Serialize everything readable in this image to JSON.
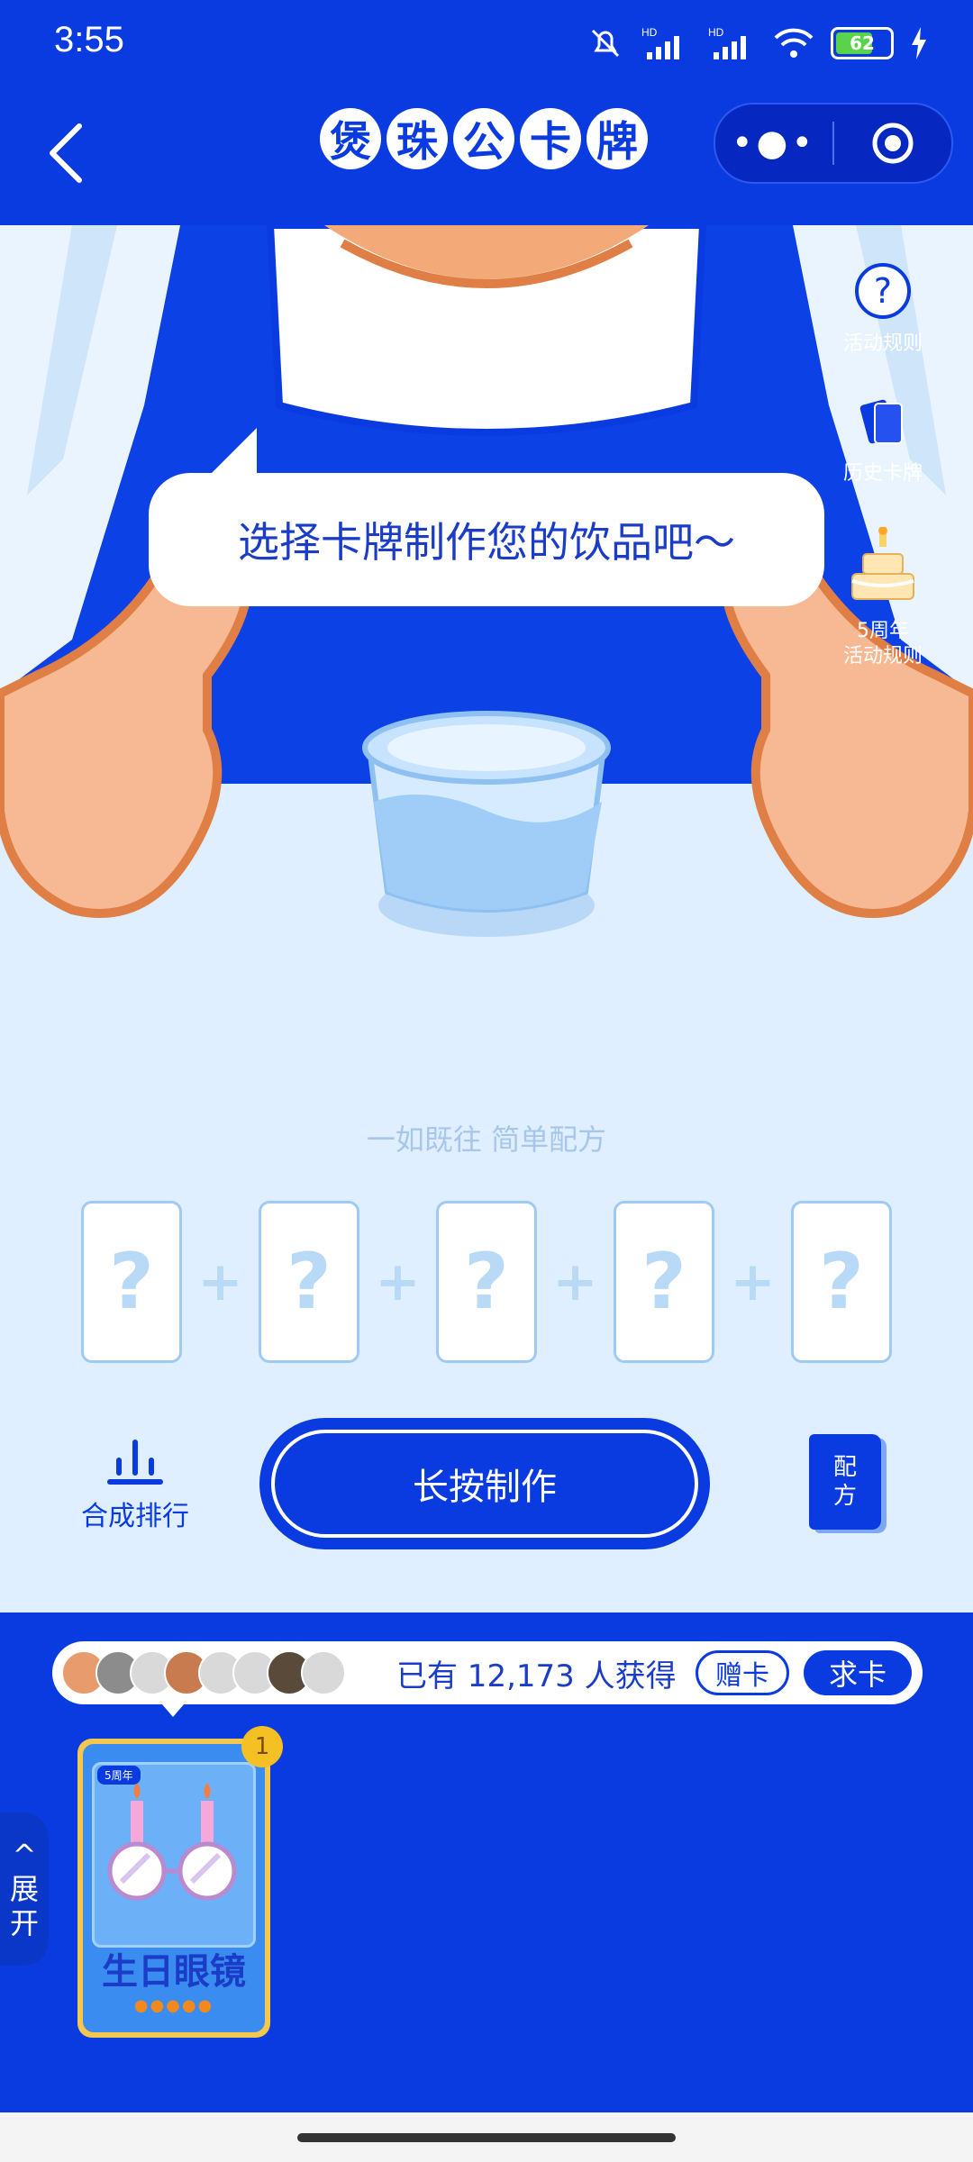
{
  "status_bar": {
    "time": "3:55",
    "hd1": "HD",
    "hd2": "HD",
    "battery": "62"
  },
  "header": {
    "title_chars": [
      "煲",
      "珠",
      "公",
      "卡",
      "牌"
    ]
  },
  "side_menu": {
    "rules": "活动规则",
    "history": "历史卡牌",
    "anniv_line1": "5周年",
    "anniv_line2": "活动规则"
  },
  "bubble_text": "选择卡牌制作您的饮品吧～",
  "slogan": "一如既往 简单配方",
  "slots": [
    "?",
    "?",
    "?",
    "?",
    "?"
  ],
  "plus": "+",
  "controls": {
    "rank": "合成排行",
    "make": "长按制作",
    "recipe_1": "配",
    "recipe_2": "方"
  },
  "owners": {
    "count_text": "已有 12,173 人获得",
    "gift": "赠卡",
    "ask": "求卡"
  },
  "expand": {
    "arrow": "^",
    "line1": "展",
    "line2": "开"
  },
  "card": {
    "tag": "5周年",
    "name": "生日眼镜",
    "badge": "1",
    "dots": "●●●●●"
  }
}
